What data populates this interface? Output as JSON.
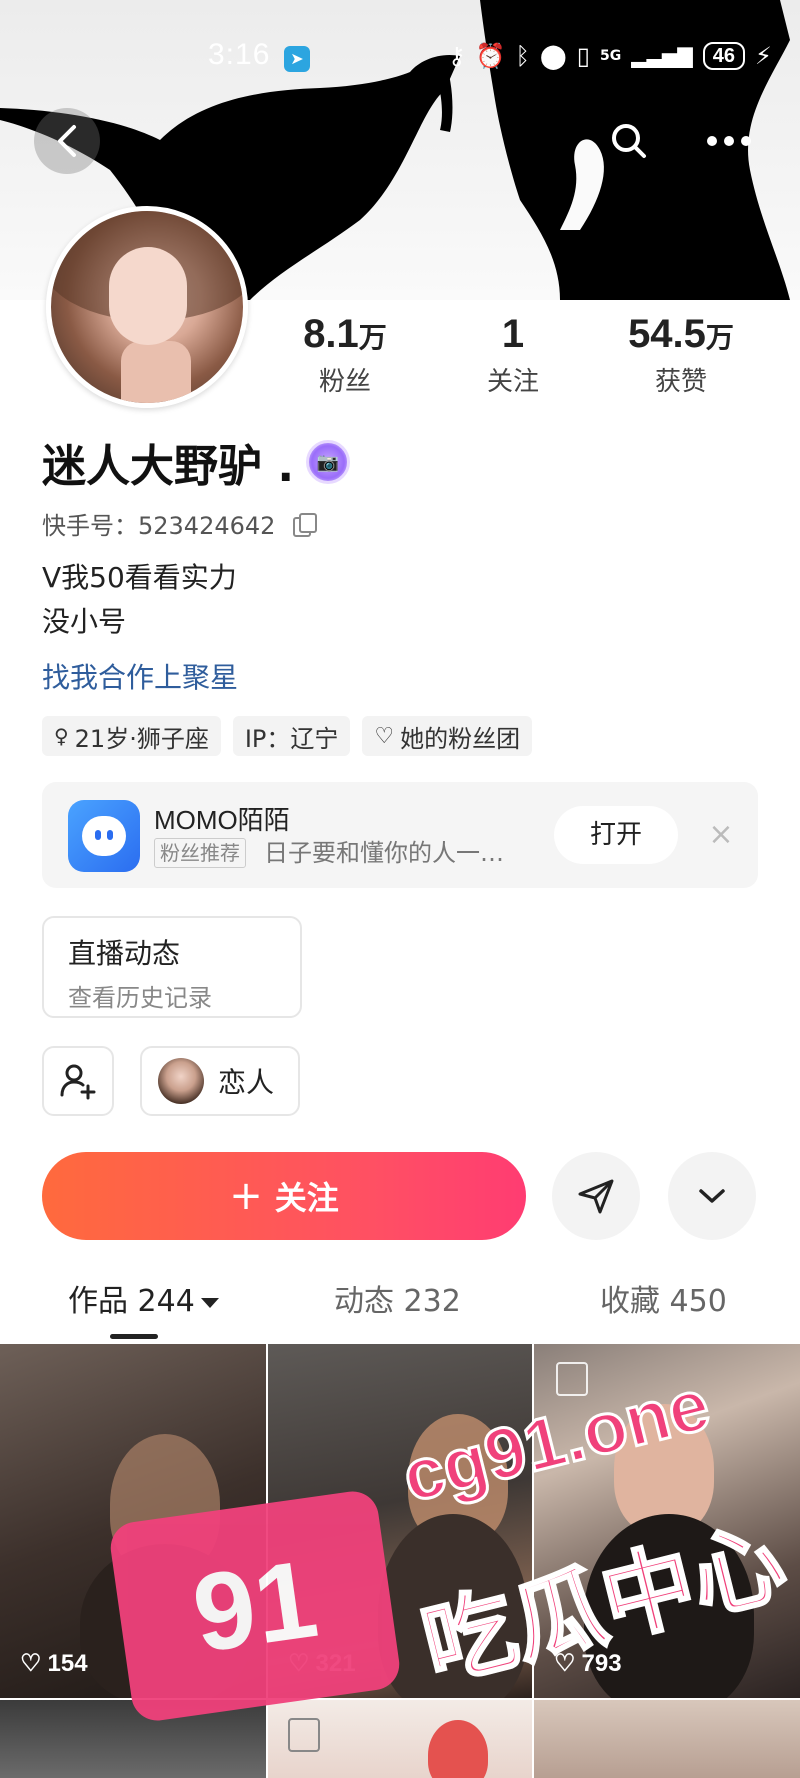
{
  "status_bar": {
    "time": "3:16",
    "network": "5G",
    "battery": "46"
  },
  "profile": {
    "stats": [
      {
        "num": "8.1",
        "unit": "万",
        "label": "粉丝"
      },
      {
        "num": "1",
        "unit": "",
        "label": "关注"
      },
      {
        "num": "54.5",
        "unit": "万",
        "label": "获赞"
      }
    ],
    "username": "迷人大野驴 .",
    "kuaishou_id": "快手号：523424642",
    "bio_line1": "V我50看看实力",
    "bio_line2": "没小号",
    "coop_link": "找我合作上聚星",
    "tags": {
      "age_sign": "21岁·狮子座",
      "ip": "IP：辽宁",
      "fan_club": "她的粉丝团"
    }
  },
  "ad": {
    "title": "MOMO陌陌",
    "tag": "粉丝推荐",
    "desc": "日子要和懂你的人一…",
    "open_label": "打开",
    "close_label": "×"
  },
  "live": {
    "title": "直播动态",
    "subtitle": "查看历史记录"
  },
  "relation": {
    "lover_label": "恋人"
  },
  "actions": {
    "follow_label": "关注",
    "follow_plus": "+"
  },
  "tabs": [
    {
      "label": "作品 244"
    },
    {
      "label": "动态 232"
    },
    {
      "label": "收藏 450"
    }
  ],
  "grid": {
    "likes": [
      "154",
      "321",
      "793"
    ]
  },
  "watermark": {
    "badge": "91",
    "url": "cg91.one",
    "text": "吃瓜中心"
  },
  "colors": {
    "follow_gradient_start": "#ff6a3d",
    "follow_gradient_end": "#ff3c72",
    "link_blue": "#2f5d9c",
    "watermark_pink": "#f0417b"
  }
}
